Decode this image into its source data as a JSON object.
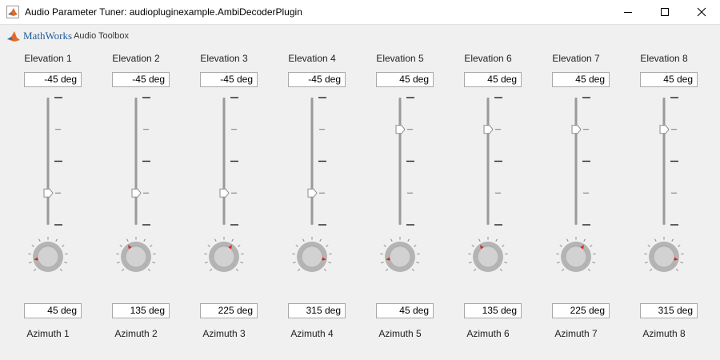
{
  "window": {
    "title": "Audio Parameter Tuner: audiopluginexample.AmbiDecoderPlugin",
    "minimize_icon": "minimize-icon",
    "maximize_icon": "maximize-icon",
    "close_icon": "close-icon"
  },
  "logo": {
    "brand": "MathWorks",
    "product": "Audio Toolbox"
  },
  "slider_range": [
    -90,
    90
  ],
  "channels": [
    {
      "elevation_label": "Elevation 1",
      "elevation_value": "-45 deg",
      "elevation": -45,
      "azimuth_label": "Azimuth 1",
      "azimuth_value": "45 deg",
      "azimuth": 45
    },
    {
      "elevation_label": "Elevation 2",
      "elevation_value": "-45 deg",
      "elevation": -45,
      "azimuth_label": "Azimuth 2",
      "azimuth_value": "135 deg",
      "azimuth": 135
    },
    {
      "elevation_label": "Elevation 3",
      "elevation_value": "-45 deg",
      "elevation": -45,
      "azimuth_label": "Azimuth 3",
      "azimuth_value": "225 deg",
      "azimuth": 225
    },
    {
      "elevation_label": "Elevation 4",
      "elevation_value": "-45 deg",
      "elevation": -45,
      "azimuth_label": "Azimuth 4",
      "azimuth_value": "315 deg",
      "azimuth": 315
    },
    {
      "elevation_label": "Elevation 5",
      "elevation_value": "45 deg",
      "elevation": 45,
      "azimuth_label": "Azimuth 5",
      "azimuth_value": "45 deg",
      "azimuth": 45
    },
    {
      "elevation_label": "Elevation 6",
      "elevation_value": "45 deg",
      "elevation": 45,
      "azimuth_label": "Azimuth 6",
      "azimuth_value": "135 deg",
      "azimuth": 135
    },
    {
      "elevation_label": "Elevation 7",
      "elevation_value": "45 deg",
      "elevation": 45,
      "azimuth_label": "Azimuth 7",
      "azimuth_value": "225 deg",
      "azimuth": 225
    },
    {
      "elevation_label": "Elevation 8",
      "elevation_value": "45 deg",
      "elevation": 45,
      "azimuth_label": "Azimuth 8",
      "azimuth_value": "315 deg",
      "azimuth": 315
    }
  ]
}
